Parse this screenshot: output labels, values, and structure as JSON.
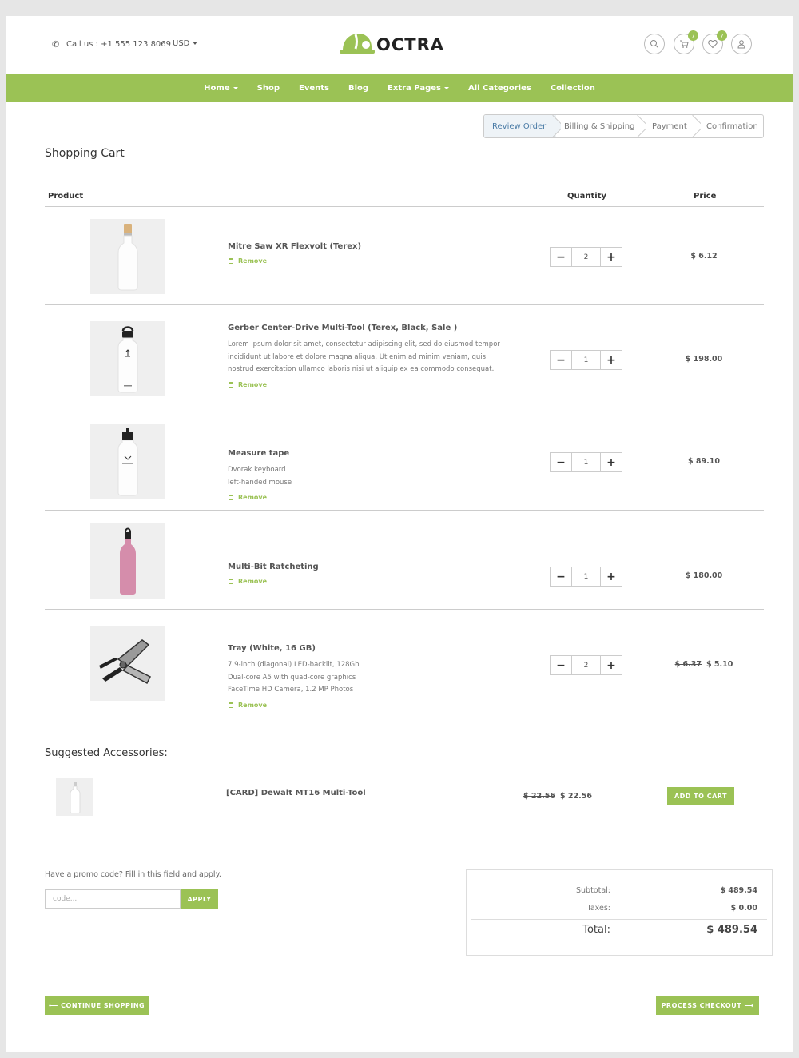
{
  "header": {
    "call": "Call us : +1 555 123 8069",
    "currency": "USD",
    "brand": "OCTRA",
    "cart_count": "7",
    "wishlist_count": "7"
  },
  "nav": [
    {
      "label": "Home",
      "caret": true
    },
    {
      "label": "Shop",
      "caret": false
    },
    {
      "label": "Events",
      "caret": false
    },
    {
      "label": "Blog",
      "caret": false
    },
    {
      "label": "Extra Pages",
      "caret": true
    },
    {
      "label": "All Categories",
      "caret": false
    },
    {
      "label": "Collection",
      "caret": false
    }
  ],
  "steps": [
    "Review Order",
    "Billing & Shipping",
    "Payment",
    "Confirmation"
  ],
  "cart": {
    "title": "Shopping Cart",
    "headers": {
      "product": "Product",
      "quantity": "Quantity",
      "price": "Price"
    },
    "remove_label": "Remove",
    "items": [
      {
        "name": "Mitre Saw XR Flexvolt (Terex)",
        "desc": [],
        "qty": "2",
        "old_price": "",
        "price": "$ 6.12",
        "image": "glass-bottle"
      },
      {
        "name": "Gerber Center-Drive Multi-Tool (Terex, Black, Sale )",
        "desc": [
          "Lorem ipsum dolor sit amet, consectetur adipiscing elit, sed do eiusmod tempor",
          "incididunt ut labore et dolore magna aliqua. Ut enim ad minim veniam, quis",
          "nostrud exercitation ullamco laboris nisi ut aliquip ex ea commodo consequat."
        ],
        "qty": "1",
        "old_price": "",
        "price": "$ 198.00",
        "image": "white-flask"
      },
      {
        "name": "Measure tape",
        "desc": [
          "Dvorak keyboard",
          "left-handed mouse"
        ],
        "qty": "1",
        "old_price": "",
        "price": "$ 89.10",
        "image": "sport-bottle"
      },
      {
        "name": "Multi-Bit Ratcheting",
        "desc": [],
        "qty": "1",
        "old_price": "",
        "price": "$ 180.00",
        "image": "pink-bottle"
      },
      {
        "name": "Tray (White, 16 GB)",
        "desc": [
          "7.9-inch (diagonal) LED-backlit, 128Gb",
          "Dual-core A5 with quad-core graphics",
          "FaceTime HD Camera, 1.2 MP Photos"
        ],
        "qty": "2",
        "old_price": "$ 6.37",
        "price": "$ 5.10",
        "image": "multi-tool"
      }
    ]
  },
  "suggested": {
    "title": "Suggested Accessories:",
    "name": "[CARD] Dewalt MT16 Multi-Tool",
    "old_price": "$ 22.56",
    "price": "$ 22.56",
    "button": "ADD TO CART"
  },
  "promo": {
    "label": "Have a promo code? Fill in this field and apply.",
    "placeholder": "code...",
    "button": "APPLY"
  },
  "totals": {
    "subtotal_label": "Subtotal:",
    "subtotal": "$ 489.54",
    "taxes_label": "Taxes:",
    "taxes": "$ 0.00",
    "total_label": "Total:",
    "total": "$ 489.54"
  },
  "actions": {
    "continue": "⟵ CONTINUE SHOPPING",
    "checkout": "PROCESS CHECKOUT ⟶"
  },
  "colors": {
    "accent": "#9bc255",
    "step_active": "#4a7ba6"
  }
}
